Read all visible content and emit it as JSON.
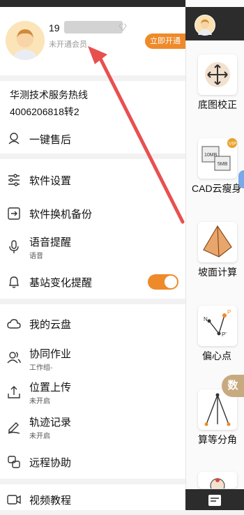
{
  "profile": {
    "phone_prefix": "19",
    "vip_status": "未开通会员",
    "open_button": "立即开通"
  },
  "hotline": {
    "title": "华测技术服务热线",
    "number": "4006206818转2"
  },
  "menu": {
    "after_sales": "一键售后",
    "software_settings": "软件设置",
    "phone_backup": "软件换机备份",
    "voice_alert": {
      "label": "语音提醒",
      "sub": "语音"
    },
    "base_station_alert": {
      "label": "基站变化提醒",
      "toggle_on": true
    },
    "cloud_disk": "我的云盘",
    "collab": {
      "label": "协同作业",
      "sub": "工作组-"
    },
    "location_upload": {
      "label": "位置上传",
      "sub": "未开启"
    },
    "track_record": {
      "label": "轨迹记录",
      "sub": "未开启"
    },
    "remote_assist": "远程协助",
    "video_tutorial": "视频教程"
  },
  "right_panel": {
    "tiles": [
      {
        "label": "底图校正",
        "icon": "move-arrows-icon"
      },
      {
        "label": "CAD云瘦身",
        "icon": "cad-file-size-icon",
        "badge": "VIP",
        "size_a": "10MB",
        "size_b": "5MB"
      },
      {
        "label": "坡面计算",
        "icon": "pyramid-icon"
      },
      {
        "label": "偏心点",
        "icon": "eccentric-point-icon",
        "point_labels": [
          "N",
          "P",
          "P'"
        ]
      },
      {
        "label": "算等分角",
        "icon": "bisect-angle-icon"
      }
    ],
    "floating_tab": "数"
  },
  "colors": {
    "accent": "#ef8a2a"
  }
}
